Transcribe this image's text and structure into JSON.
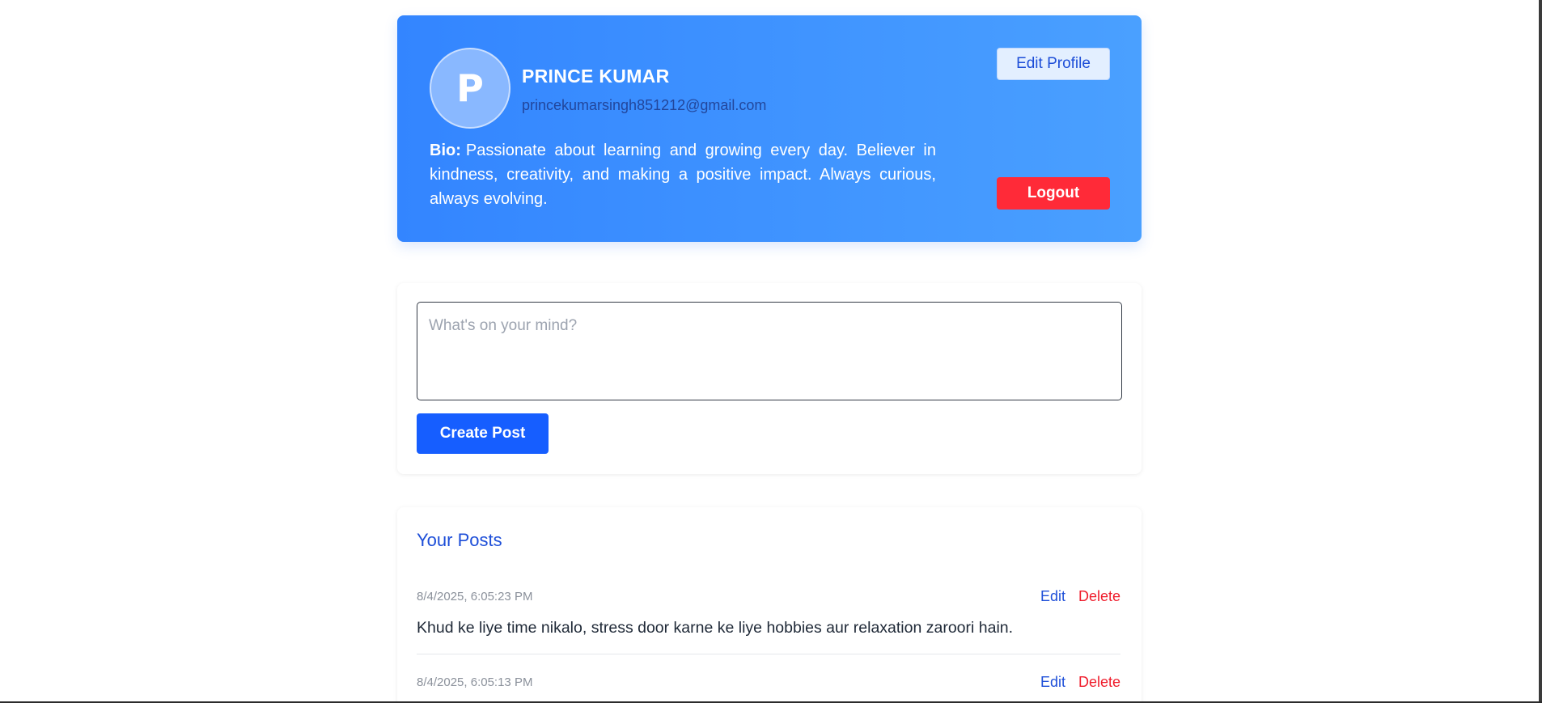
{
  "profile": {
    "avatar_letter": "P",
    "name": "PRINCE KUMAR",
    "email": "princekumarsingh851212@gmail.com",
    "bio_label": "Bio:",
    "bio_text": "Passionate about learning and growing every day. Believer in kindness, creativity, and making a positive impact. Always curious, always evolving.",
    "edit_profile_label": "Edit Profile",
    "logout_label": "Logout"
  },
  "composer": {
    "placeholder": "What's on your mind?",
    "value": "",
    "create_post_label": "Create Post"
  },
  "posts": {
    "title": "Your Posts",
    "items": [
      {
        "timestamp": "8/4/2025, 6:05:23 PM",
        "edit_label": "Edit",
        "delete_label": "Delete",
        "content": "Khud ke liye time nikalo, stress door karne ke liye hobbies aur relaxation zaroori hain."
      },
      {
        "timestamp": "8/4/2025, 6:05:13 PM",
        "edit_label": "Edit",
        "delete_label": "Delete"
      }
    ]
  },
  "colors": {
    "accent": "#165eff",
    "profile_gradient_start": "#3385ff",
    "profile_gradient_end": "#4aa0ff",
    "danger": "#ff2a38",
    "link": "#1d4ed8"
  }
}
